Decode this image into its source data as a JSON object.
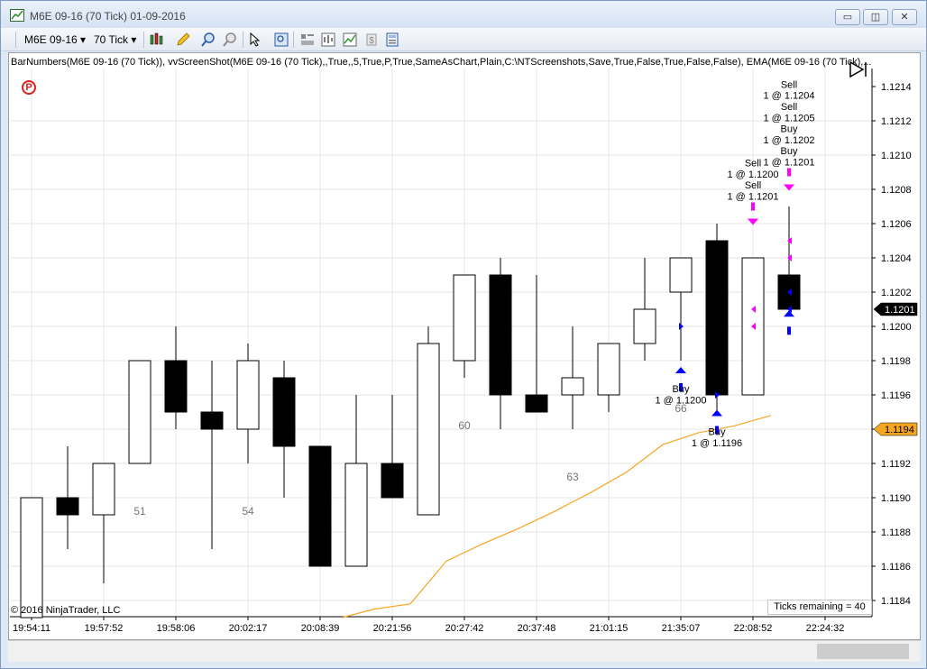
{
  "window": {
    "title": "M6E 09-16 (70 Tick)  01-09-2016",
    "minimize": "▭",
    "restore": "◫",
    "close": "✕"
  },
  "toolbar": {
    "instrument": "M6E 09-16",
    "interval": "70 Tick",
    "dropdown_glyph": "▾"
  },
  "indicator_text": "BarNumbers(M6E 09-16 (70 Tick)), vvScreenShot(M6E 09-16 (70 Tick),,True,,5,True,P,True,SameAsChart,Plain,C:\\NTScreenshots,Save,True,False,True,False,False), EMA(M6E 09-16 (70 Tick),...",
  "badge": "P",
  "copyright": "© 2016 NinjaTrader, LLC",
  "ticks_remaining": "Ticks remaining = 40",
  "colors": {
    "up_candle": "#ffffff",
    "down_candle": "#000000",
    "ema": "#f5a623",
    "buy_arrow": "#0000ff",
    "sell_arrow": "#ff00ff",
    "last_price_bg": "#000000",
    "ema_label_bg": "#f5a623",
    "grid": "#e6e6e6"
  },
  "chart_data": {
    "type": "candlestick",
    "instrument": "M6E 09-16",
    "bar_type": "70 Tick",
    "ylim": [
      1.1183,
      1.1216
    ],
    "y_ticks": [
      "1.1212",
      "1.1210",
      "1.1208",
      "1.1206",
      "1.1204",
      "1.1202",
      "1.1200",
      "1.1198",
      "1.1196",
      "1.1194",
      "1.1192",
      "1.1190",
      "1.1188",
      "1.1186",
      "1.1184"
    ],
    "y_tick_values": [
      1.1212,
      1.121,
      1.1208,
      1.1206,
      1.1204,
      1.1202,
      1.12,
      1.1198,
      1.1196,
      1.1194,
      1.1192,
      1.119,
      1.1188,
      1.1186,
      1.1184
    ],
    "top_label": "1.1214",
    "x_ticks": [
      "19:54:11",
      "19:57:52",
      "19:58:06",
      "20:02:17",
      "20:08:39",
      "20:21:56",
      "20:27:42",
      "20:37:48",
      "21:01:15",
      "21:35:07",
      "22:08:52",
      "22:24:32"
    ],
    "x_tick_bars": [
      0,
      2,
      4,
      6,
      8,
      10,
      12,
      14,
      16,
      18,
      20,
      22
    ],
    "bars": [
      {
        "o": 1.1183,
        "h": 1.119,
        "l": 1.1183,
        "c": 1.119
      },
      {
        "o": 1.119,
        "h": 1.1193,
        "l": 1.1187,
        "c": 1.1189
      },
      {
        "o": 1.1189,
        "h": 1.1192,
        "l": 1.1185,
        "c": 1.1192
      },
      {
        "o": 1.1192,
        "h": 1.1198,
        "l": 1.1192,
        "c": 1.1198
      },
      {
        "o": 1.1198,
        "h": 1.12,
        "l": 1.1194,
        "c": 1.1195
      },
      {
        "o": 1.1195,
        "h": 1.1198,
        "l": 1.1187,
        "c": 1.1194
      },
      {
        "o": 1.1194,
        "h": 1.1199,
        "l": 1.1192,
        "c": 1.1198
      },
      {
        "o": 1.1197,
        "h": 1.1198,
        "l": 1.119,
        "c": 1.1193
      },
      {
        "o": 1.1193,
        "h": 1.1193,
        "l": 1.1186,
        "c": 1.1186
      },
      {
        "o": 1.1186,
        "h": 1.1196,
        "l": 1.1186,
        "c": 1.1192
      },
      {
        "o": 1.1192,
        "h": 1.1196,
        "l": 1.119,
        "c": 1.119
      },
      {
        "o": 1.1189,
        "h": 1.12,
        "l": 1.1189,
        "c": 1.1199
      },
      {
        "o": 1.1198,
        "h": 1.1203,
        "l": 1.1197,
        "c": 1.1203
      },
      {
        "o": 1.1203,
        "h": 1.1204,
        "l": 1.1194,
        "c": 1.1196
      },
      {
        "o": 1.1196,
        "h": 1.1203,
        "l": 1.1195,
        "c": 1.1195
      },
      {
        "o": 1.1196,
        "h": 1.12,
        "l": 1.1194,
        "c": 1.1197
      },
      {
        "o": 1.1196,
        "h": 1.1199,
        "l": 1.1195,
        "c": 1.1199
      },
      {
        "o": 1.1199,
        "h": 1.1204,
        "l": 1.1198,
        "c": 1.1201
      },
      {
        "o": 1.1202,
        "h": 1.1204,
        "l": 1.1198,
        "c": 1.1204
      },
      {
        "o": 1.1205,
        "h": 1.1206,
        "l": 1.1195,
        "c": 1.1196
      },
      {
        "o": 1.1196,
        "h": 1.1204,
        "l": 1.1196,
        "c": 1.1204
      },
      {
        "o": 1.1203,
        "h": 1.1207,
        "l": 1.1201,
        "c": 1.1201
      }
    ],
    "bar_numbers": [
      {
        "bar": 3,
        "label": "51",
        "y": 1.1189
      },
      {
        "bar": 6,
        "label": "54",
        "y": 1.1189
      },
      {
        "bar": 12,
        "label": "60",
        "y": 1.1194
      },
      {
        "bar": 15,
        "label": "63",
        "y": 1.1191
      },
      {
        "bar": 18,
        "label": "66",
        "y": 1.1195
      }
    ],
    "ema": {
      "name": "EMA",
      "bars": [
        8.6,
        9.5,
        10.5,
        11.5,
        12.5,
        13.5,
        14.5,
        15.5,
        16.5,
        17.5,
        18.5,
        19.5,
        20.5
      ],
      "values": [
        1.1183,
        1.11835,
        1.11838,
        1.11863,
        1.11873,
        1.11882,
        1.11892,
        1.11903,
        1.11915,
        1.11931,
        1.11938,
        1.11942,
        1.11948
      ]
    },
    "executions": [
      {
        "bar": 18,
        "side": "Buy",
        "lines": [
          "Buy",
          "1 @ 1.1200"
        ],
        "arrow_y": 1.1197
      },
      {
        "bar": 19,
        "side": "Buy",
        "lines": [
          "Buy",
          "1 @ 1.1196"
        ],
        "arrow_y": 1.11945
      },
      {
        "bar": 20,
        "side": "Sell",
        "lines": [
          "Sell",
          "1 @ 1.1200",
          "Sell",
          "1 @ 1.1201"
        ],
        "arrow_y": 1.12065
      },
      {
        "bar": 21,
        "side": "Sell",
        "lines": [
          "Sell",
          "1 @ 1.1204",
          "Sell",
          "1 @ 1.1205",
          "Buy",
          "1 @ 1.1202",
          "Buy",
          "1 @ 1.1201"
        ],
        "arrow_y": 1.12085
      },
      {
        "bar": 21,
        "side": "Buy",
        "lines": [],
        "arrow_y": 1.12003
      }
    ],
    "fill_markers": [
      {
        "bar": 18,
        "y": 1.12,
        "dir": "right",
        "color": "buy"
      },
      {
        "bar": 19,
        "y": 1.1196,
        "dir": "right",
        "color": "buy"
      },
      {
        "bar": 20,
        "y": 1.1201,
        "dir": "left",
        "color": "sell"
      },
      {
        "bar": 20,
        "y": 1.12,
        "dir": "left",
        "color": "sell"
      },
      {
        "bar": 21,
        "y": 1.1205,
        "dir": "left",
        "color": "sell"
      },
      {
        "bar": 21,
        "y": 1.1204,
        "dir": "left",
        "color": "sell"
      },
      {
        "bar": 21,
        "y": 1.1202,
        "dir": "left",
        "color": "buy"
      },
      {
        "bar": 21,
        "y": 1.1201,
        "dir": "left",
        "color": "buy"
      }
    ],
    "last_price": {
      "label": "1.1201",
      "value": 1.1201
    },
    "ema_price": {
      "label": "1.1194",
      "value": 1.1194
    }
  }
}
